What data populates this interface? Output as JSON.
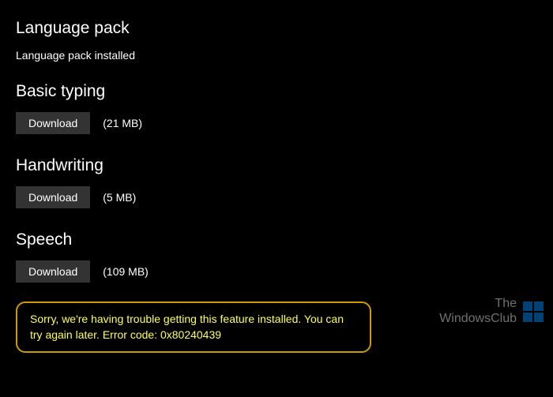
{
  "sections": {
    "language_pack": {
      "title": "Language pack",
      "status": "Language pack installed"
    },
    "basic_typing": {
      "title": "Basic typing",
      "button_label": "Download",
      "size": "(21 MB)"
    },
    "handwriting": {
      "title": "Handwriting",
      "button_label": "Download",
      "size": "(5 MB)"
    },
    "speech": {
      "title": "Speech",
      "button_label": "Download",
      "size": "(109 MB)"
    }
  },
  "error": {
    "message": "Sorry, we're having trouble getting this feature installed. You can try again later. Error code: 0x80240439"
  },
  "watermark": {
    "line1": "The",
    "line2": "WindowsClub"
  }
}
